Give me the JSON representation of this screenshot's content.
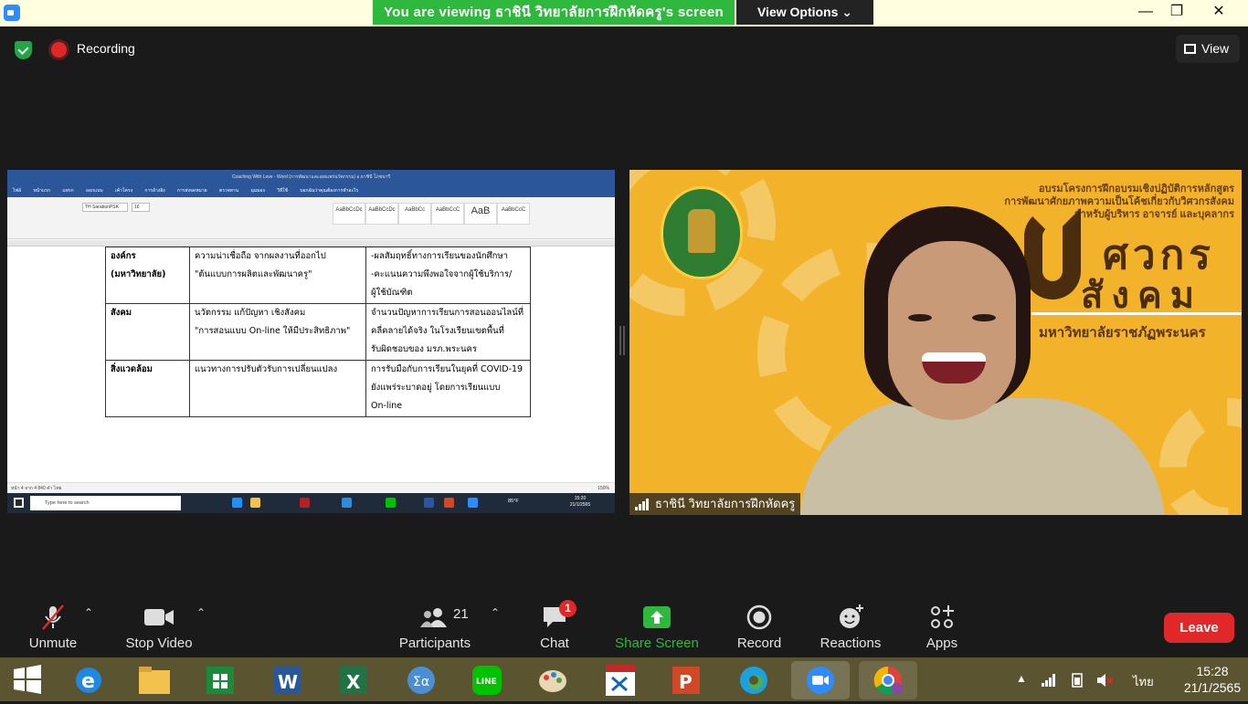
{
  "window": {
    "banner_text": "You are viewing ธาชินี วิทยาลัยการฝึกหัดครู's screen",
    "view_options_label": "View Options ⌄",
    "minimize": "—",
    "maximize": "❐",
    "close": "✕"
  },
  "top_bar": {
    "recording_label": "Recording",
    "view_label": "View"
  },
  "shared_screen": {
    "word_title": "Coaching With Love - Word (การพัฒนาและเผยแพร่นวัตกรรม)    อ.ธาชินี โภชนารี",
    "word_tabs": [
      "ไฟล์",
      "หน้าแรก",
      "แทรก",
      "ออกแบบ",
      "เค้าโครง",
      "การอ้างอิง",
      "การส่งจดหมาย",
      "ตรวจทาน",
      "มุมมอง",
      "วิธีใช้",
      "บอกฉันว่าคุณต้องการทำอะไร"
    ],
    "font_name": "TH SarabunPSK",
    "font_size": "16",
    "styles": [
      "AaBbCcDc",
      "AaBbCcDc",
      "AaBbCc",
      "AaBbCcC",
      "AaB",
      "AaBbCcC"
    ],
    "table_rows": [
      {
        "c1": "องค์กร\n(มหาวิทยาลัย)",
        "c2": "ความน่าเชื่อถือ จากผลงานที่ออกไป\n\"ต้นแบบการผลิตและพัฒนาครู\"",
        "c3": "-ผลสัมฤทธิ์ทางการเรียนของนักศึกษา\n-คะแนนความพึงพอใจจากผู้ใช้บริการ/\nผู้ใช้บัณฑิต"
      },
      {
        "c1": "สังคม",
        "c2": "นวัตกรรม  แก้ปัญหา เชิงสังคม\n\"การสอนแบบ  On-line ให้มีประสิทธิภาพ\"",
        "c3": "จำนวนปัญหาการเรียนการสอนออนไลน์ที่\nคลี่คลายได้จริง  ในโรงเรียนเขตพื้นที่\nรับผิดชอบของ มรภ.พระนคร"
      },
      {
        "c1": "สิ่งแวดล้อม",
        "c2": "แนวทางการปรับตัวรับการเปลี่ยนแปลง",
        "c3": "การรับมือกับการเรียนในยุคที่  COVID-19\nยังแพร่ระบาดอยู่  โดยการเรียนแบบ\nOn-line"
      }
    ],
    "status_text": "หน้า 4 จาก 4    840 คำ    ไทย",
    "zoom": "150%",
    "search_placeholder": "Type here to search",
    "weather": "85°F",
    "clock_time": "15:20",
    "clock_date": "21/1/2565"
  },
  "camera": {
    "headline": "อบรมโครงการฝึกอบรมเชิงปฏิบัติการหลักสูตร\nการพัฒนาศักยภาพความเป็นโค้ชเกี่ยวกับวิศวกรสังคม\nสำหรับผู้บริหาร อาจารย์ และบุคลากร",
    "big_line1": "ศวกร",
    "big_line2": "สังคม",
    "university": "มหาวิทยาลัยราชภัฏพระนคร",
    "participant_name": "ธาชินี  วิทยาลัยการฝึกหัดครู"
  },
  "toolbar": {
    "unmute": "Unmute",
    "stop_video": "Stop Video",
    "participants": "Participants",
    "participants_count": "21",
    "chat": "Chat",
    "chat_badge": "1",
    "share_screen": "Share Screen",
    "record": "Record",
    "reactions": "Reactions",
    "apps": "Apps",
    "leave": "Leave"
  },
  "taskbar": {
    "language": "ไทย",
    "time": "15:28",
    "date": "21/1/2565"
  },
  "colors": {
    "zoom_green": "#2eb83d",
    "leave_red": "#e02828",
    "camera_bg": "#f2b32b",
    "word_blue": "#2b579a"
  }
}
